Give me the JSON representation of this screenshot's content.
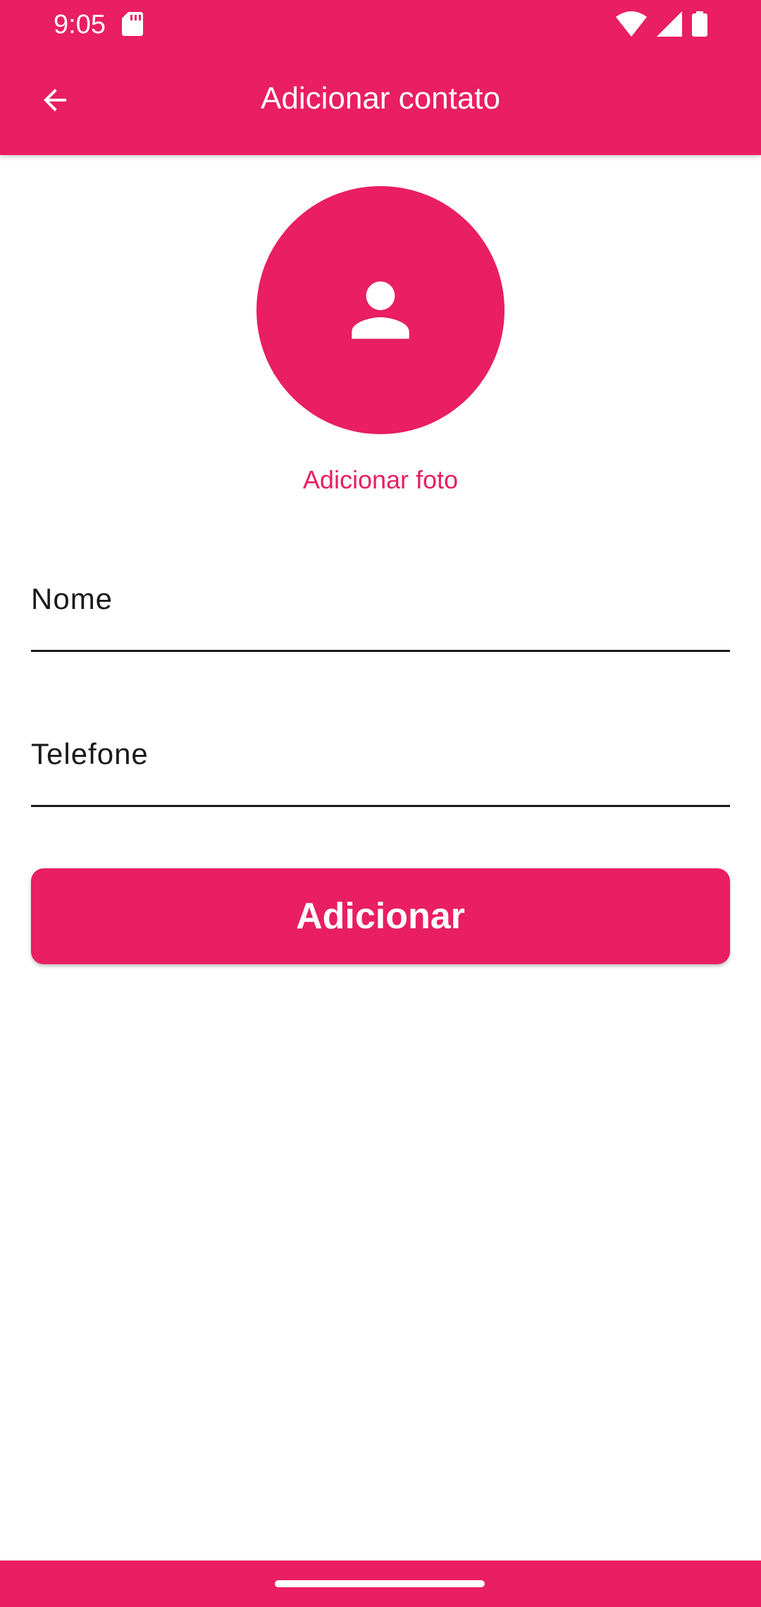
{
  "status_bar": {
    "time": "9:05",
    "icons": [
      "sd-card-icon",
      "wifi-icon",
      "signal-icon",
      "battery-icon"
    ]
  },
  "app_bar": {
    "back_icon": "arrow-back-icon",
    "title": "Adicionar contato"
  },
  "photo": {
    "avatar_icon": "person-icon",
    "add_label": "Adicionar foto"
  },
  "form": {
    "name_label": "Nome",
    "phone_label": "Telefone",
    "submit_label": "Adicionar"
  },
  "colors": {
    "primary": "#E91E63",
    "on_primary": "#FFFFFF",
    "text": "#1A1A1A",
    "background": "#FFFFFF"
  }
}
